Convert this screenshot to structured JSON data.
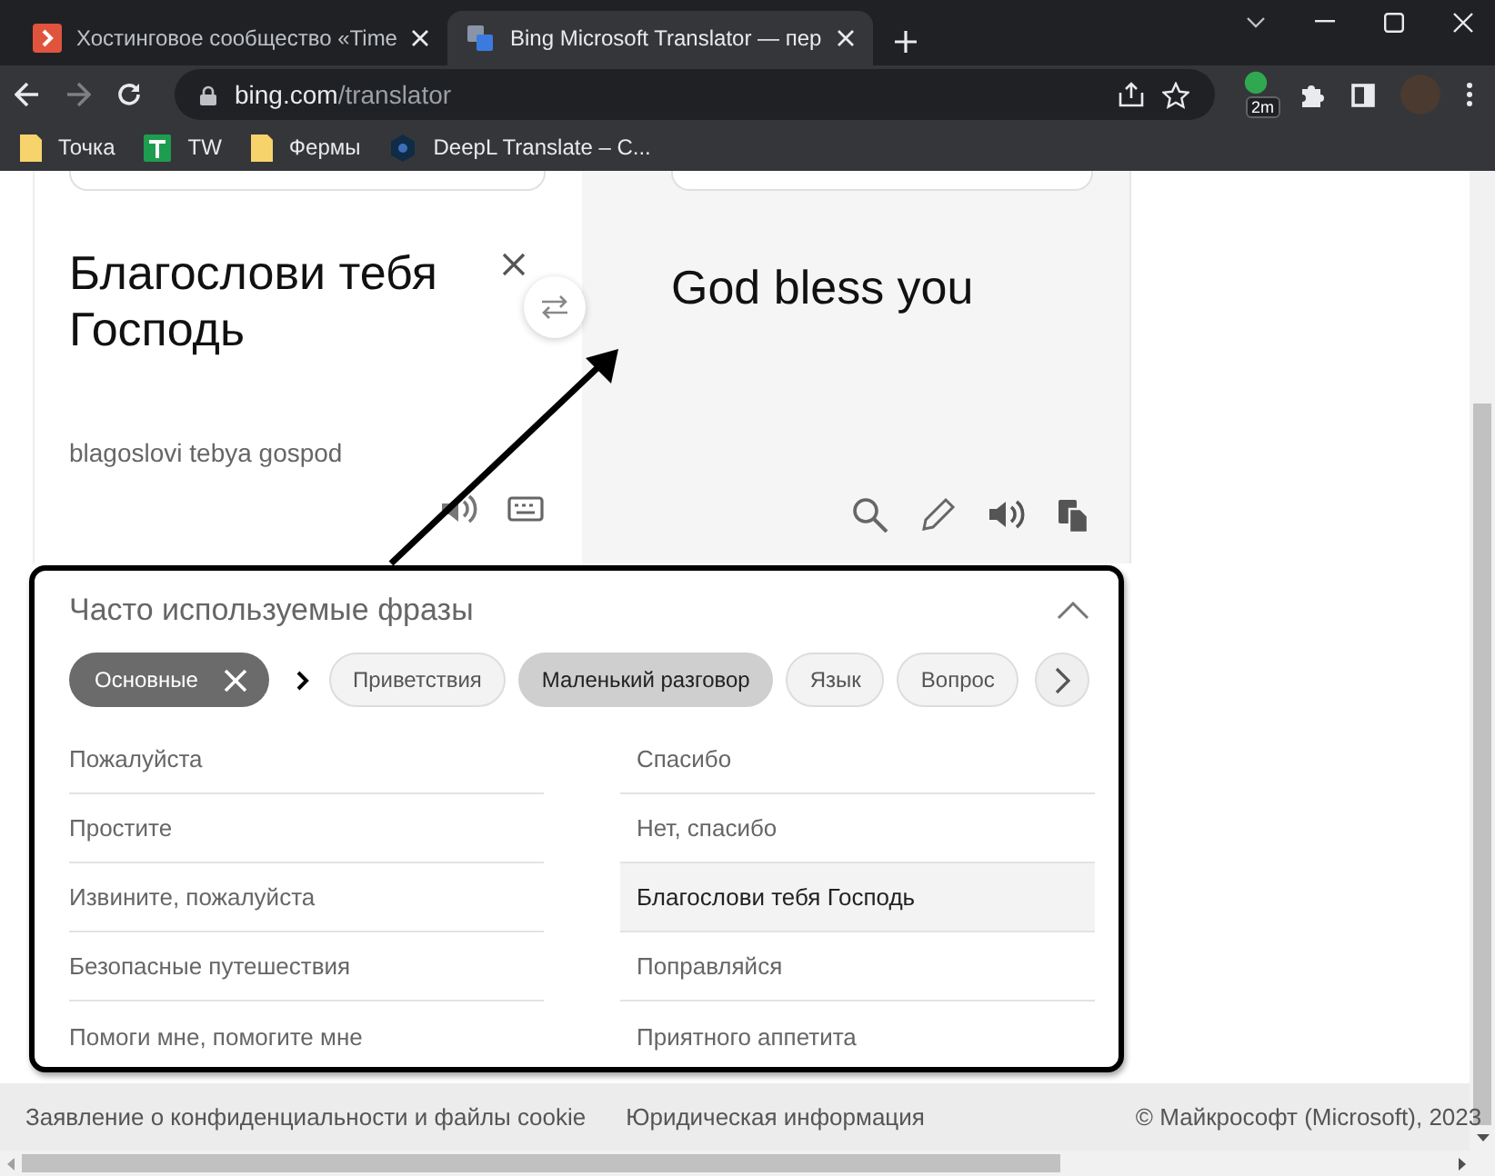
{
  "browser": {
    "tabs": [
      {
        "title": "Хостинговое сообщество «Time",
        "selected": false,
        "kind": "hosting"
      },
      {
        "title": "Bing Microsoft Translator — пер",
        "selected": true,
        "kind": "translator"
      }
    ],
    "address": {
      "host": "bing.com",
      "path": "/translator"
    },
    "extension_badge": "2m",
    "bookmarks": [
      {
        "label": "Точка",
        "kind": "folder"
      },
      {
        "label": "TW",
        "kind": "sheet"
      },
      {
        "label": "Фермы",
        "kind": "folder"
      },
      {
        "label": "DeepL Translate – C...",
        "kind": "deepl"
      }
    ]
  },
  "translator": {
    "source_text": "Благослови тебя Господь",
    "transliteration": "blagoslovi tebya gospod",
    "target_text": "God bless you"
  },
  "phrases": {
    "title": "Часто используемые фразы",
    "expanded": true,
    "category": {
      "label": "Основные"
    },
    "subcategories": [
      {
        "label": "Приветствия",
        "selected": false
      },
      {
        "label": "Маленький разговор",
        "selected": true
      },
      {
        "label": "Язык",
        "selected": false
      },
      {
        "label": "Вопрос",
        "selected": false
      }
    ],
    "items": [
      {
        "text": "Пожалуйста",
        "selected": false
      },
      {
        "text": "Простите",
        "selected": false
      },
      {
        "text": "Извините, пожалуйста",
        "selected": false
      },
      {
        "text": "Безопасные путешествия",
        "selected": false
      },
      {
        "text": "Помоги мне, помогите мне",
        "selected": false
      },
      {
        "text": "Спасибо",
        "selected": false
      },
      {
        "text": "Нет, спасибо",
        "selected": false
      },
      {
        "text": "Благослови тебя Господь",
        "selected": true
      },
      {
        "text": "Поправляйся",
        "selected": false
      },
      {
        "text": "Приятного аппетита",
        "selected": false
      }
    ]
  },
  "footer": {
    "links": [
      {
        "text": "Заявление о конфиденциальности и файлы cookie"
      },
      {
        "text": "Юридическая информация"
      }
    ],
    "copyright": "© Майкрософт (Microsoft), 2023"
  }
}
